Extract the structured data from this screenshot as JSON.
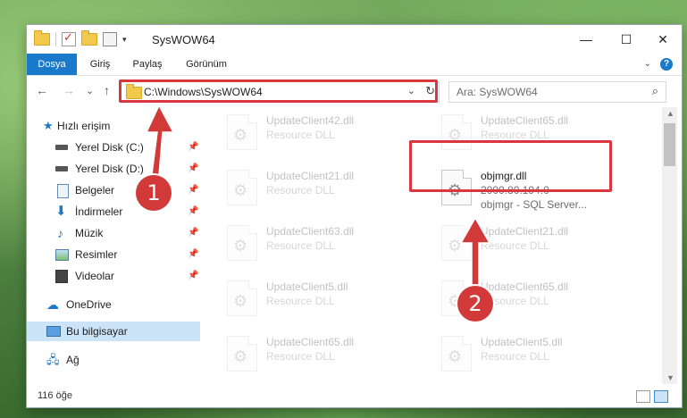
{
  "window": {
    "title": "SysWOW64",
    "controls": {
      "minimize": "—",
      "maximize": "☐",
      "close": "✕"
    }
  },
  "ribbon": {
    "tabs": [
      "Dosya",
      "Giriş",
      "Paylaş",
      "Görünüm"
    ],
    "help": "?",
    "collapse": "⌄"
  },
  "navigation": {
    "back": "←",
    "forward": "→",
    "recent": "⌄",
    "up": "↑",
    "address": "C:\\Windows\\SysWOW64",
    "address_dropdown": "⌄",
    "refresh": "↻",
    "search_placeholder": "Ara: SysWOW64",
    "search_icon": "⌕"
  },
  "sidebar": {
    "items": [
      {
        "label": "Hızlı erişim",
        "icon": "star-icon",
        "pinned": false
      },
      {
        "label": "Yerel Disk (C:)",
        "icon": "drive-icon",
        "pinned": true
      },
      {
        "label": "Yerel Disk (D:)",
        "icon": "drive-icon",
        "pinned": true
      },
      {
        "label": "Belgeler",
        "icon": "documents-icon",
        "pinned": true
      },
      {
        "label": "İndirmeler",
        "icon": "download-icon",
        "pinned": true
      },
      {
        "label": "Müzik",
        "icon": "music-icon",
        "pinned": true
      },
      {
        "label": "Resimler",
        "icon": "pictures-icon",
        "pinned": true
      },
      {
        "label": "Videolar",
        "icon": "videos-icon",
        "pinned": true
      },
      {
        "label": "OneDrive",
        "icon": "cloud-icon",
        "pinned": false
      },
      {
        "label": "Bu bilgisayar",
        "icon": "computer-icon",
        "pinned": false
      },
      {
        "label": "Ağ",
        "icon": "network-icon",
        "pinned": false
      }
    ],
    "pin_glyph": "📌"
  },
  "files": {
    "left": [
      {
        "name": "UpdateClient42.dll",
        "desc": "Resource DLL"
      },
      {
        "name": "UpdateClient21.dll",
        "desc": "Resource DLL"
      },
      {
        "name": "UpdateClient63.dll",
        "desc": "Resource DLL"
      },
      {
        "name": "UpdateClient5.dll",
        "desc": "Resource DLL"
      },
      {
        "name": "UpdateClient65.dll",
        "desc": "Resource DLL"
      }
    ],
    "right": [
      {
        "name": "UpdateClient65.dll",
        "desc": "Resource DLL"
      },
      {
        "name": "UpdateClient21.dll",
        "desc": "Resource DLL"
      },
      {
        "name": "UpdateClient65.dll",
        "desc": "Resource DLL"
      },
      {
        "name": "UpdateClient5.dll",
        "desc": "Resource DLL"
      }
    ],
    "highlighted": {
      "name": "objmgr.dll",
      "version": "2000.80.194.0",
      "desc": "objmgr - SQL Server..."
    }
  },
  "status": {
    "count": "116 öğe"
  },
  "annotations": {
    "step1": "1",
    "step2": "2",
    "color": "#d23a3a"
  }
}
